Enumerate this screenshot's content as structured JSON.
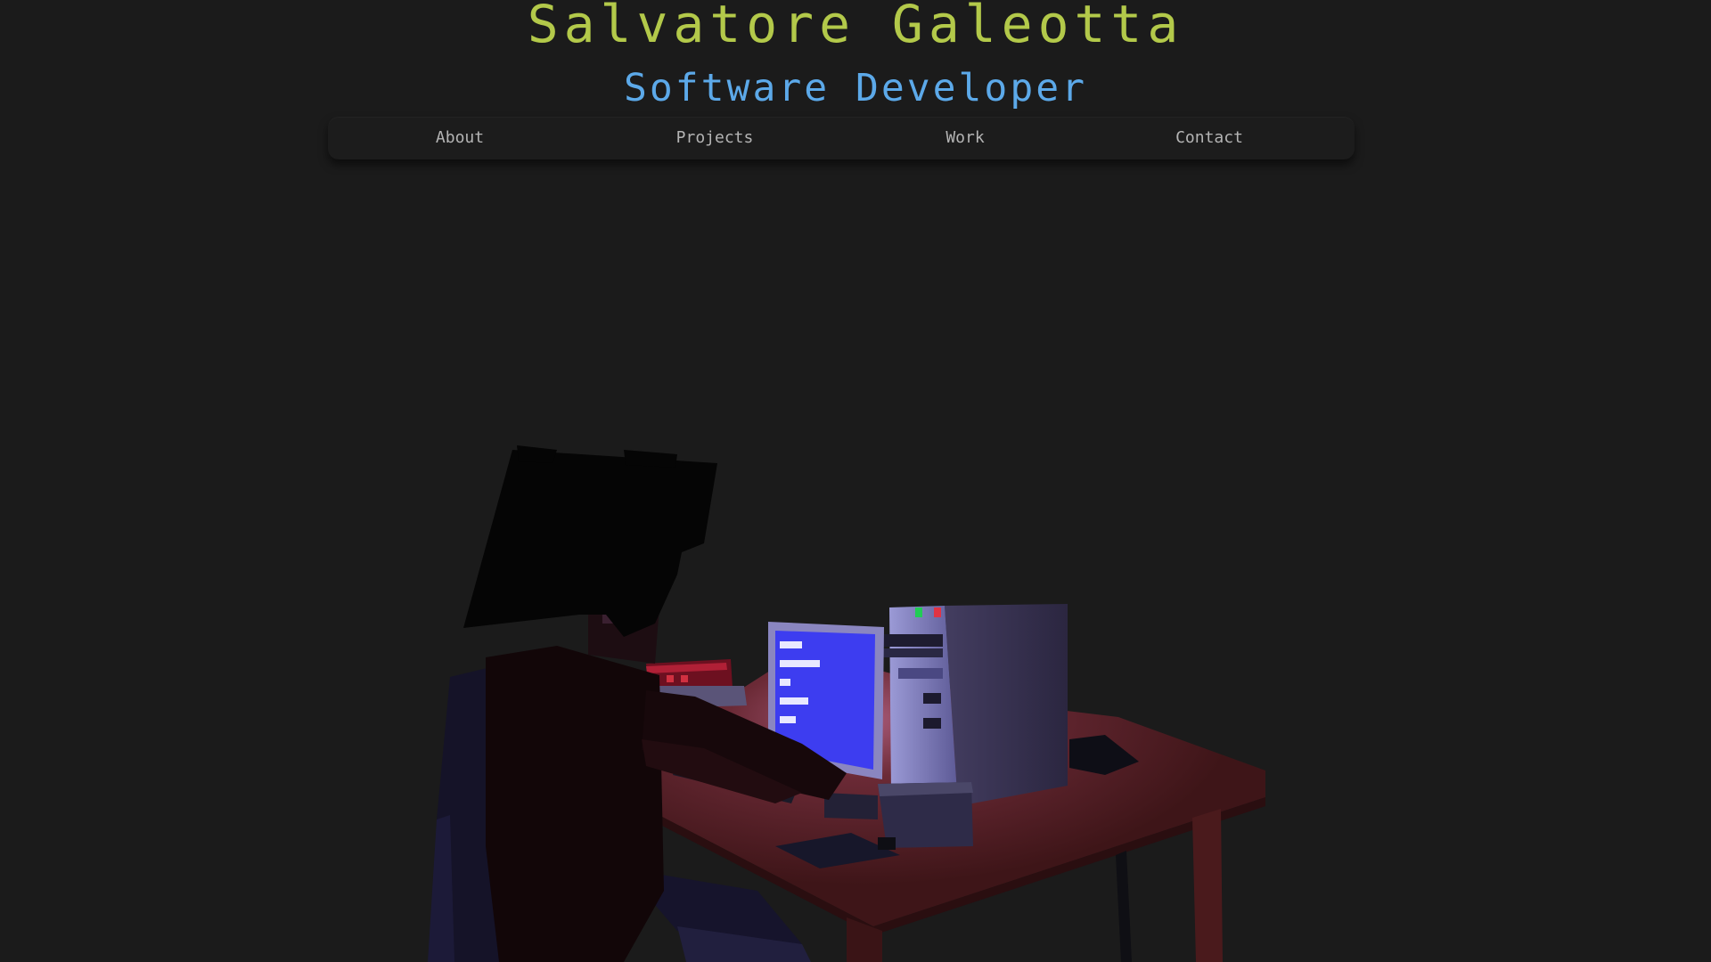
{
  "header": {
    "title": "Salvatore Galeotta",
    "subtitle": "Software Developer"
  },
  "nav": {
    "items": [
      {
        "label": "About"
      },
      {
        "label": "Projects"
      },
      {
        "label": "Work"
      },
      {
        "label": "Contact"
      }
    ]
  },
  "colors": {
    "background": "#1b1b1b",
    "title": "#b3c94a",
    "subtitle": "#5ca9e9",
    "nav_text": "#b4b4b4",
    "screen": "#3d3df0",
    "desk": "#5a1f1f",
    "led_green": "#22cc55",
    "led_red": "#e23344"
  },
  "scene": {
    "icon": "voxel-developer-at-desk-illustration"
  }
}
